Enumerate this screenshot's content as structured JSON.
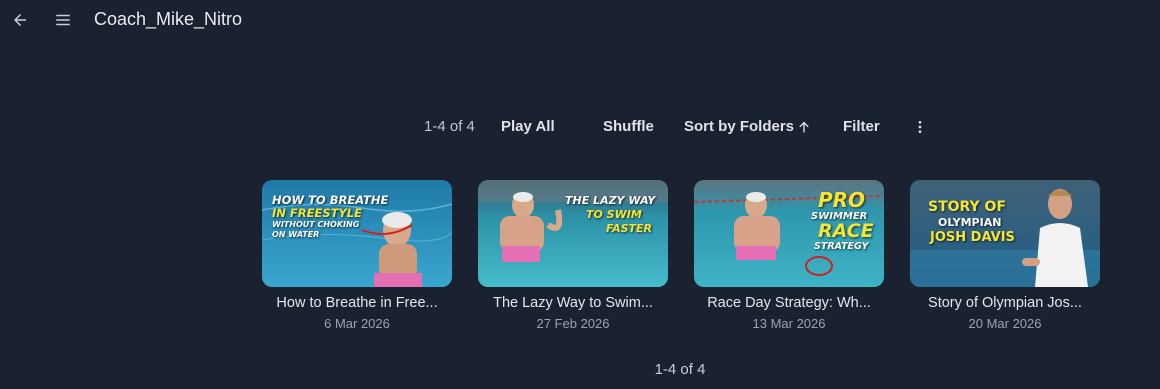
{
  "header": {
    "title": "Coach_Mike_Nitro",
    "back_icon": "arrow-left-icon",
    "menu_icon": "hamburger-menu-icon"
  },
  "toolbar": {
    "count": "1-4 of 4",
    "play_all": "Play All",
    "shuffle": "Shuffle",
    "sort": "Sort by Folders",
    "sort_icon": "arrow-up-icon",
    "filter": "Filter",
    "more_icon": "more-vertical-icon"
  },
  "videos": [
    {
      "title": "How to Breathe in Free...",
      "date": "6 Mar 2026",
      "thumb_lines": [
        "HOW TO BREATHE",
        "IN FREESTYLE",
        "WITHOUT CHOKING",
        "ON WATER"
      ]
    },
    {
      "title": "The Lazy Way to Swim...",
      "date": "27 Feb 2026",
      "thumb_lines": [
        "THE LAZY WAY",
        "TO SWIM",
        "FASTER"
      ]
    },
    {
      "title": "Race Day Strategy: Wh...",
      "date": "13 Mar 2026",
      "thumb_lines": [
        "PRO",
        "SWIMMER",
        "RACE",
        "STRATEGY"
      ]
    },
    {
      "title": "Story of Olympian Jos...",
      "date": "20 Mar 2026",
      "thumb_lines": [
        "STORY OF",
        "OLYMPIAN",
        "JOSH DAVIS"
      ]
    }
  ],
  "footer": {
    "count": "1-4 of 4"
  },
  "colors": {
    "background": "#1a2230",
    "thumb_yellow": "#f5e431",
    "pool_blue": "#2a8fb8"
  }
}
